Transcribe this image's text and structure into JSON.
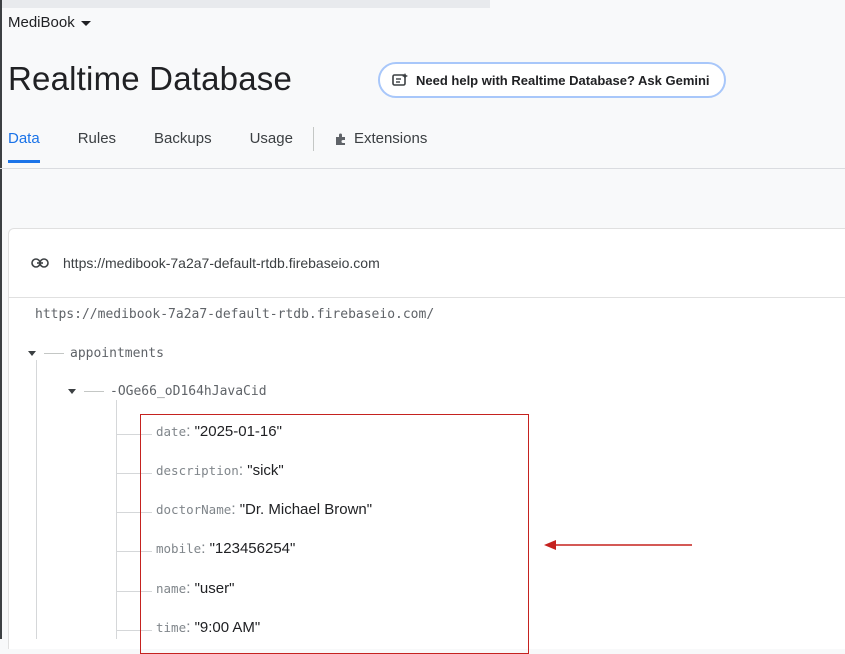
{
  "project": {
    "name": "MediBook"
  },
  "header": {
    "title": "Realtime Database",
    "gemini_chip": "Need help with Realtime Database? Ask Gemini"
  },
  "tabs": [
    {
      "label": "Data",
      "active": true
    },
    {
      "label": "Rules",
      "active": false
    },
    {
      "label": "Backups",
      "active": false
    },
    {
      "label": "Usage",
      "active": false
    },
    {
      "label": "Extensions",
      "active": false
    }
  ],
  "database": {
    "url": "https://medibook-7a2a7-default-rtdb.firebaseio.com",
    "root": "https://medibook-7a2a7-default-rtdb.firebaseio.com/",
    "node": "appointments",
    "child": "-OGe66_oD164hJavaCid",
    "fields": [
      {
        "key": "date",
        "value": "\"2025-01-16\""
      },
      {
        "key": "description",
        "value": "\"sick\""
      },
      {
        "key": "doctorName",
        "value": "\"Dr. Michael Brown\""
      },
      {
        "key": "mobile",
        "value": "\"123456254\""
      },
      {
        "key": "name",
        "value": "\"user\""
      },
      {
        "key": "time",
        "value": "\"9:00 AM\""
      }
    ]
  },
  "colors": {
    "accent": "#1a73e8",
    "highlight": "#c5221f",
    "chip_border": "#a8c7fa"
  }
}
